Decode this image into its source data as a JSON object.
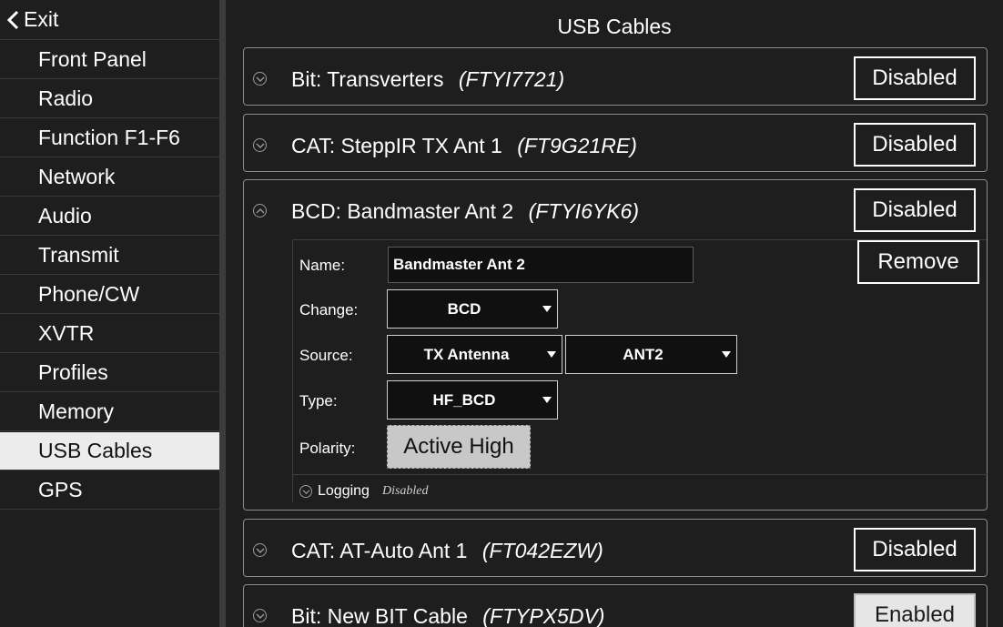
{
  "sidebar": {
    "exit_label": "Exit",
    "items": [
      {
        "label": "Front Panel"
      },
      {
        "label": "Radio"
      },
      {
        "label": "Function F1-F6"
      },
      {
        "label": "Network"
      },
      {
        "label": "Audio"
      },
      {
        "label": "Transmit"
      },
      {
        "label": "Phone/CW"
      },
      {
        "label": "XVTR"
      },
      {
        "label": "Profiles"
      },
      {
        "label": "Memory"
      },
      {
        "label": "USB Cables"
      },
      {
        "label": "GPS"
      }
    ],
    "active_item": "USB Cables"
  },
  "main": {
    "title": "USB Cables",
    "cables": [
      {
        "type": "Bit:",
        "name": "Transverters",
        "serial": "(FTYI7721)",
        "status": "Disabled"
      },
      {
        "type": "CAT:",
        "name": "SteppIR TX Ant 1",
        "serial": "(FT9G21RE)",
        "status": "Disabled"
      },
      {
        "type": "BCD:",
        "name": "Bandmaster Ant 2",
        "serial": "(FTYI6YK6)",
        "status": "Disabled"
      },
      {
        "type": "CAT:",
        "name": "AT-Auto Ant 1",
        "serial": "(FT042EZW)",
        "status": "Disabled"
      },
      {
        "type": "Bit:",
        "name": "New BIT Cable",
        "serial": "(FTYPX5DV)",
        "status": "Enabled"
      }
    ],
    "expanded": {
      "name_label": "Name:",
      "name_value": "Bandmaster Ant 2",
      "change_label": "Change:",
      "change_value": "BCD",
      "source_label": "Source:",
      "source_value": "TX Antenna",
      "source_port_value": "ANT2",
      "type_label": "Type:",
      "type_value": "HF_BCD",
      "polarity_label": "Polarity:",
      "polarity_value": "Active High",
      "remove_label": "Remove",
      "logging_label": "Logging",
      "logging_status": "Disabled"
    }
  },
  "colors": {
    "background": "#1e1e1e",
    "active_item_bg": "#ececec",
    "border": "#8a8a8a"
  }
}
